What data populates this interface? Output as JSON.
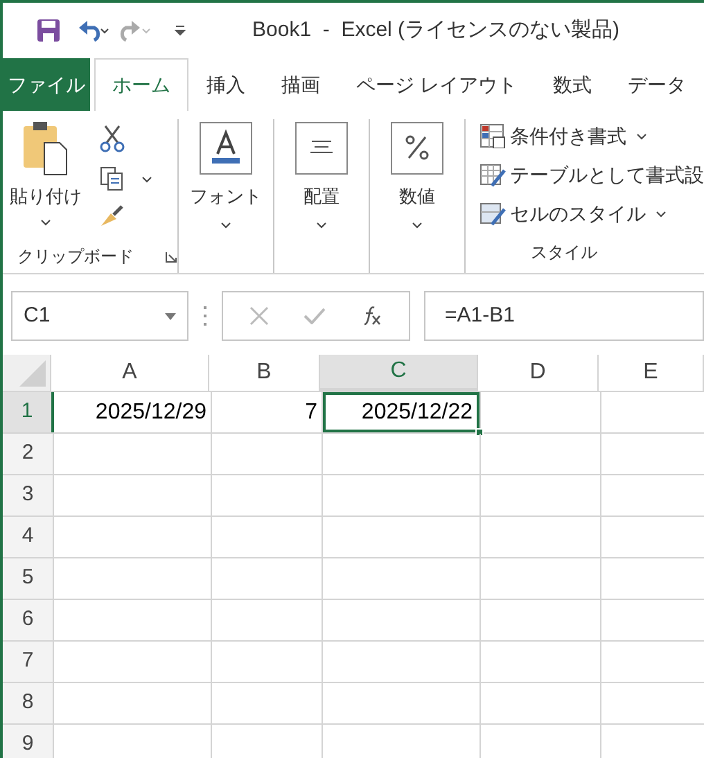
{
  "window": {
    "title": "Book1  -  Excel (ライセンスのない製品)"
  },
  "tabs": [
    {
      "label": "ファイル",
      "kind": "file"
    },
    {
      "label": "ホーム",
      "kind": "tab",
      "selected": true
    },
    {
      "label": "挿入",
      "kind": "tab",
      "selected": false
    },
    {
      "label": "描画",
      "kind": "tab",
      "selected": false
    },
    {
      "label": "ページ レイアウト",
      "kind": "tab",
      "selected": false
    },
    {
      "label": "数式",
      "kind": "tab",
      "selected": false
    },
    {
      "label": "データ",
      "kind": "tab",
      "selected": false
    }
  ],
  "ribbon": {
    "clipboard": {
      "paste": "貼り付け",
      "label": "クリップボード"
    },
    "font": {
      "label": "フォント"
    },
    "alignment": {
      "label": "配置"
    },
    "number": {
      "label": "数値"
    },
    "styles": {
      "items": [
        "条件付き書式",
        "テーブルとして書式設",
        "セルのスタイル"
      ],
      "label": "スタイル"
    }
  },
  "formula_bar": {
    "name_box": "C1",
    "formula": "=A1-B1"
  },
  "columns": [
    {
      "label": "A",
      "selected": false
    },
    {
      "label": "B",
      "selected": false
    },
    {
      "label": "C",
      "selected": true
    },
    {
      "label": "D",
      "selected": false
    },
    {
      "label": "E",
      "selected": false
    }
  ],
  "rows": [
    {
      "label": "1",
      "selected": true,
      "cells": [
        {
          "value": "2025/12/29",
          "selected": false
        },
        {
          "value": "7",
          "selected": false
        },
        {
          "value": "2025/12/22",
          "selected": true
        }
      ]
    },
    {
      "label": "2",
      "selected": false
    },
    {
      "label": "3",
      "selected": false
    },
    {
      "label": "4",
      "selected": false
    },
    {
      "label": "5",
      "selected": false
    },
    {
      "label": "6",
      "selected": false
    },
    {
      "label": "7",
      "selected": false
    },
    {
      "label": "8",
      "selected": false
    },
    {
      "label": "9",
      "selected": false
    }
  ]
}
